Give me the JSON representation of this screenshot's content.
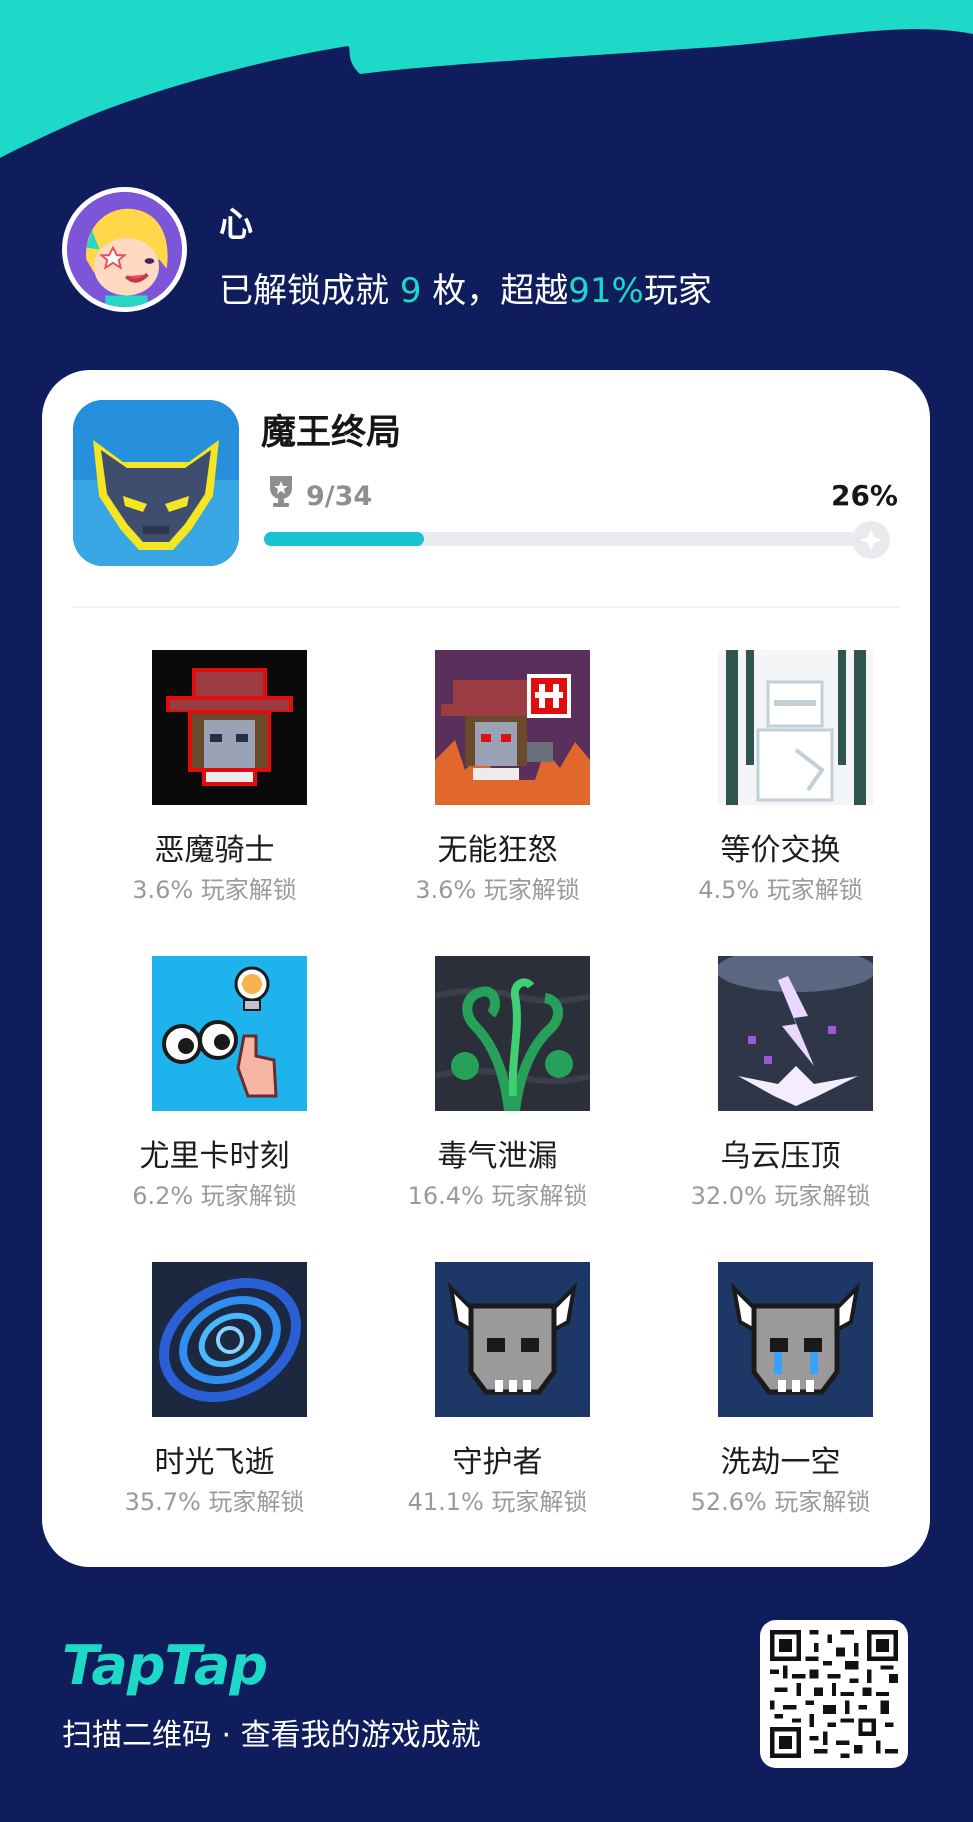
{
  "user": {
    "name": "心",
    "summary_prefix": "已解锁成就 ",
    "unlocked_count": "9",
    "summary_mid": " 枚，超越",
    "beat_percent": "91%",
    "summary_suffix": "玩家"
  },
  "game": {
    "title": "魔王终局",
    "progress_text": "9/34",
    "progress_percent_text": "26%",
    "progress_fraction": 0.26
  },
  "achievements": [
    {
      "name": "恶魔骑士",
      "rate": "3.6% 玩家解锁",
      "icon": "hat-skull-red-outline-icon"
    },
    {
      "name": "无能狂怒",
      "rate": "3.6% 玩家解锁",
      "icon": "hat-skull-anger-icon"
    },
    {
      "name": "等价交换",
      "rate": "4.5% 玩家解锁",
      "icon": "ghost-knight-icon"
    },
    {
      "name": "尤里卡时刻",
      "rate": "6.2% 玩家解锁",
      "icon": "eyes-lightbulb-icon"
    },
    {
      "name": "毒气泄漏",
      "rate": "16.4% 玩家解锁",
      "icon": "poison-gas-tentacles-icon"
    },
    {
      "name": "乌云压顶",
      "rate": "32.0% 玩家解锁",
      "icon": "storm-lightning-icon"
    },
    {
      "name": "时光飞逝",
      "rate": "35.7% 玩家解锁",
      "icon": "time-vortex-icon"
    },
    {
      "name": "守护者",
      "rate": "41.1% 玩家解锁",
      "icon": "horned-skull-icon"
    },
    {
      "name": "洗劫一空",
      "rate": "52.6% 玩家解锁",
      "icon": "crying-horned-skull-icon"
    }
  ],
  "footer": {
    "brand": "TapTap",
    "scan_text": "扫描二维码 · 查看我的游戏成就"
  },
  "colors": {
    "background": "#0f1d5d",
    "accent": "#1ed8c8",
    "progress": "#16c3cf"
  }
}
